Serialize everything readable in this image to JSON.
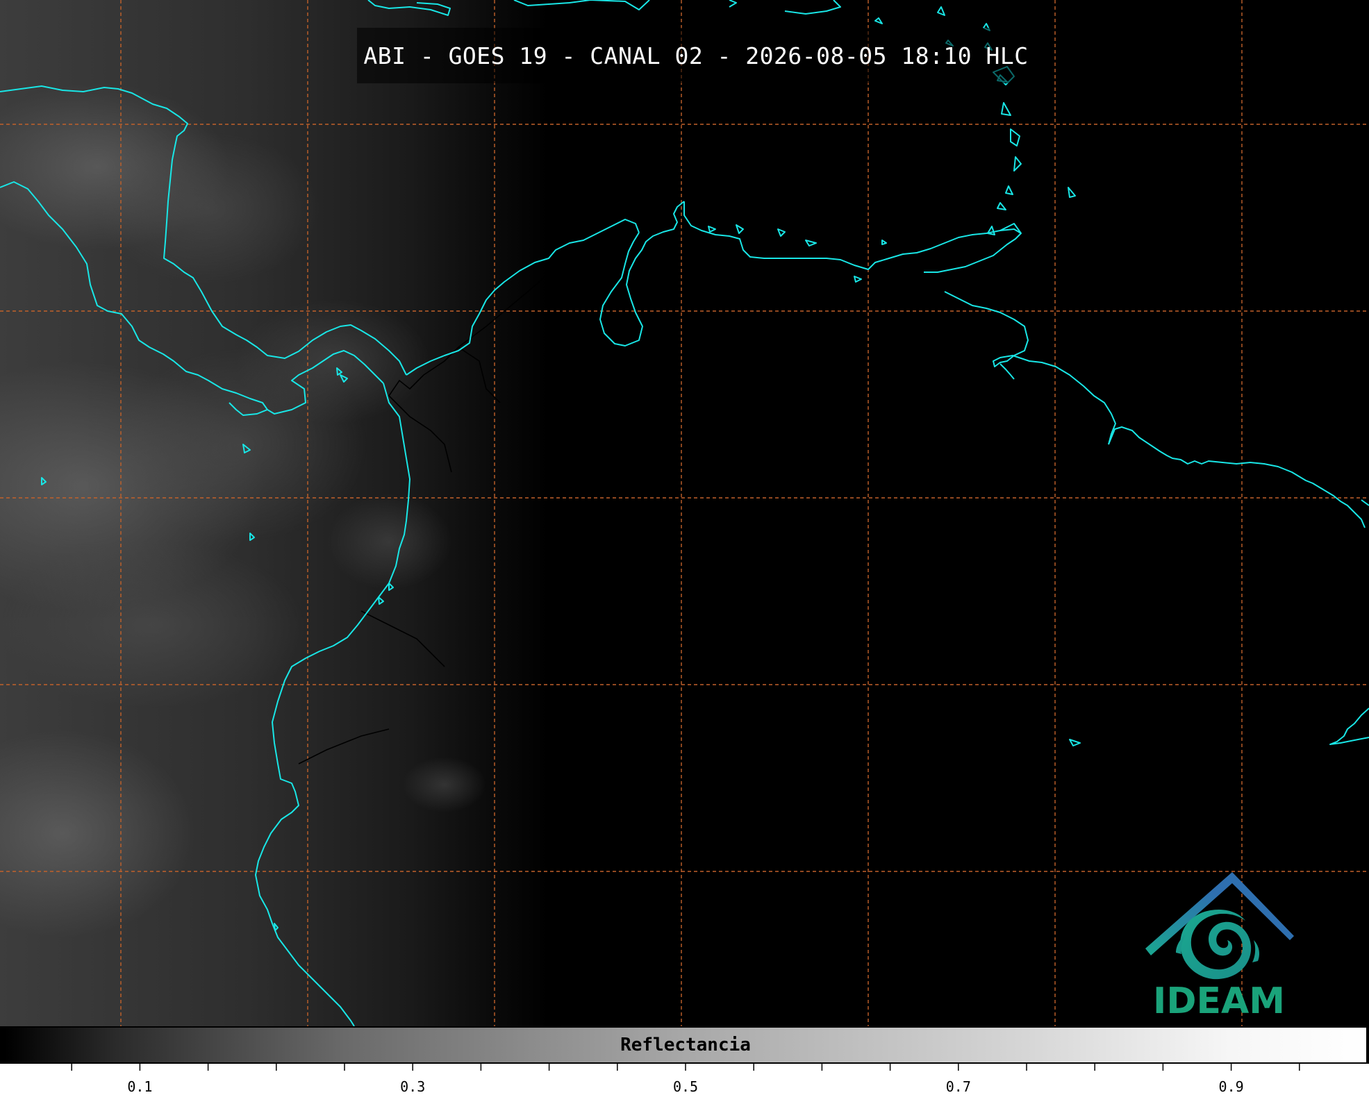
{
  "title": "ABI - GOES 19 - CANAL 02 - 2026-08-05 18:10 HLC",
  "colorbar": {
    "label": "Reflectancia",
    "range": [
      0.0,
      1.0
    ],
    "colormap": "grayscale",
    "tick_labels": [
      "0.1",
      "0.3",
      "0.5",
      "0.7",
      "0.9"
    ],
    "tick_values": [
      0.1,
      0.3,
      0.5,
      0.7,
      0.9
    ],
    "minor_tick_step": 0.05
  },
  "logo": {
    "text": "IDEAM",
    "colors": {
      "roof": "#2e6fb0",
      "swirl": "#1aa890",
      "text": "#1aa37a"
    }
  },
  "colors": {
    "background": "#000000",
    "coastline": "#19e6e6",
    "grid": "#c2612a",
    "border": "#000000",
    "text": "#ffffff"
  },
  "icons": {
    "logo": "ideam-logo-icon"
  }
}
